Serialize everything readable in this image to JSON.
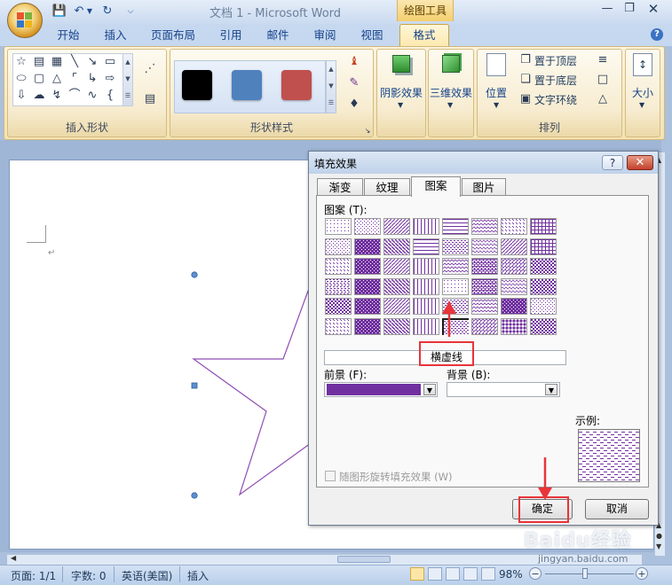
{
  "app": {
    "window_title": "文档 1 - Microsoft Word",
    "contextual_tab_group": "绘图工具"
  },
  "tabs": [
    {
      "label": "开始"
    },
    {
      "label": "插入"
    },
    {
      "label": "页面布局"
    },
    {
      "label": "引用"
    },
    {
      "label": "邮件"
    },
    {
      "label": "审阅"
    },
    {
      "label": "视图"
    },
    {
      "label": "格式"
    }
  ],
  "ribbon": {
    "insert_shapes": {
      "label": "插入形状"
    },
    "shape_styles": {
      "label": "形状样式",
      "swatches": [
        "#000000",
        "#4f81bd",
        "#c0504d"
      ]
    },
    "shadow_effects": {
      "label": "阴影效果"
    },
    "3d_effects": {
      "label": "三维效果"
    },
    "arrange": {
      "label": "排列",
      "position": "位置",
      "bring_to_front": "置于顶层",
      "send_to_back": "置于底层",
      "text_wrapping": "文字环绕"
    },
    "size": {
      "label": "大小"
    }
  },
  "dialog": {
    "title": "填充效果",
    "tabs": [
      "渐变",
      "纹理",
      "图案",
      "图片"
    ],
    "active_tab": "图案",
    "pattern_label": "图案 (T):",
    "selected_pattern_name": "横虚线",
    "foreground_label": "前景 (F):",
    "foreground_color": "#7030a0",
    "background_label": "背景 (B):",
    "sample_label": "示例:",
    "rotate_checkbox_label": "随图形旋转填充效果 (W)",
    "rotate_checked": false,
    "ok_label": "确定",
    "cancel_label": "取消"
  },
  "status": {
    "page": "页面: 1/1",
    "words": "字数: 0",
    "language": "英语(美国)",
    "mode": "插入",
    "zoom": "98%"
  },
  "watermark": {
    "text": "Baidu经验",
    "subtext": "jingyan.baidu.com"
  }
}
